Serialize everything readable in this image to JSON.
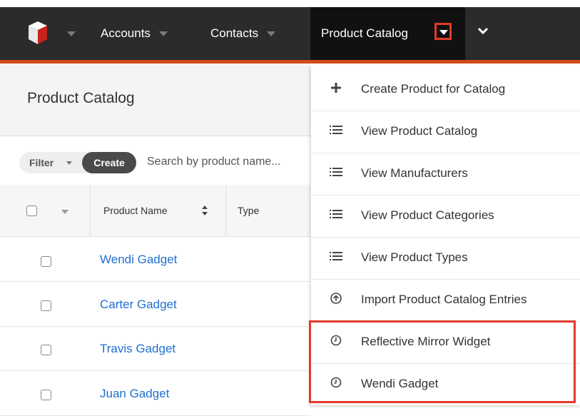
{
  "navbar": {
    "accounts": "Accounts",
    "contacts": "Contacts",
    "product_catalog": "Product Catalog"
  },
  "page": {
    "title": "Product Catalog",
    "filter_label": "Filter",
    "create_label": "Create",
    "search_placeholder": "Search by product name..."
  },
  "table": {
    "columns": [
      "Product Name",
      "Type"
    ],
    "rows": [
      "Wendi Gadget",
      "Carter Gadget",
      "Travis Gadget",
      "Juan Gadget"
    ]
  },
  "menu": {
    "items": [
      {
        "label": "Create Product for Catalog",
        "icon": "plus-icon"
      },
      {
        "label": "View Product Catalog",
        "icon": "list-icon"
      },
      {
        "label": "View Manufacturers",
        "icon": "list-icon"
      },
      {
        "label": "View Product Categories",
        "icon": "list-icon"
      },
      {
        "label": "View Product Types",
        "icon": "list-icon"
      },
      {
        "label": "Import Product Catalog Entries",
        "icon": "import-icon"
      },
      {
        "label": "Reflective Mirror Widget",
        "icon": "clock-icon"
      },
      {
        "label": "Wendi Gadget",
        "icon": "clock-icon"
      }
    ]
  },
  "colors": {
    "navbar_bg": "#2b2b2b",
    "accent_line": "#d24a1d",
    "highlight_border": "#e33a2b",
    "link": "#1f6fd1"
  }
}
